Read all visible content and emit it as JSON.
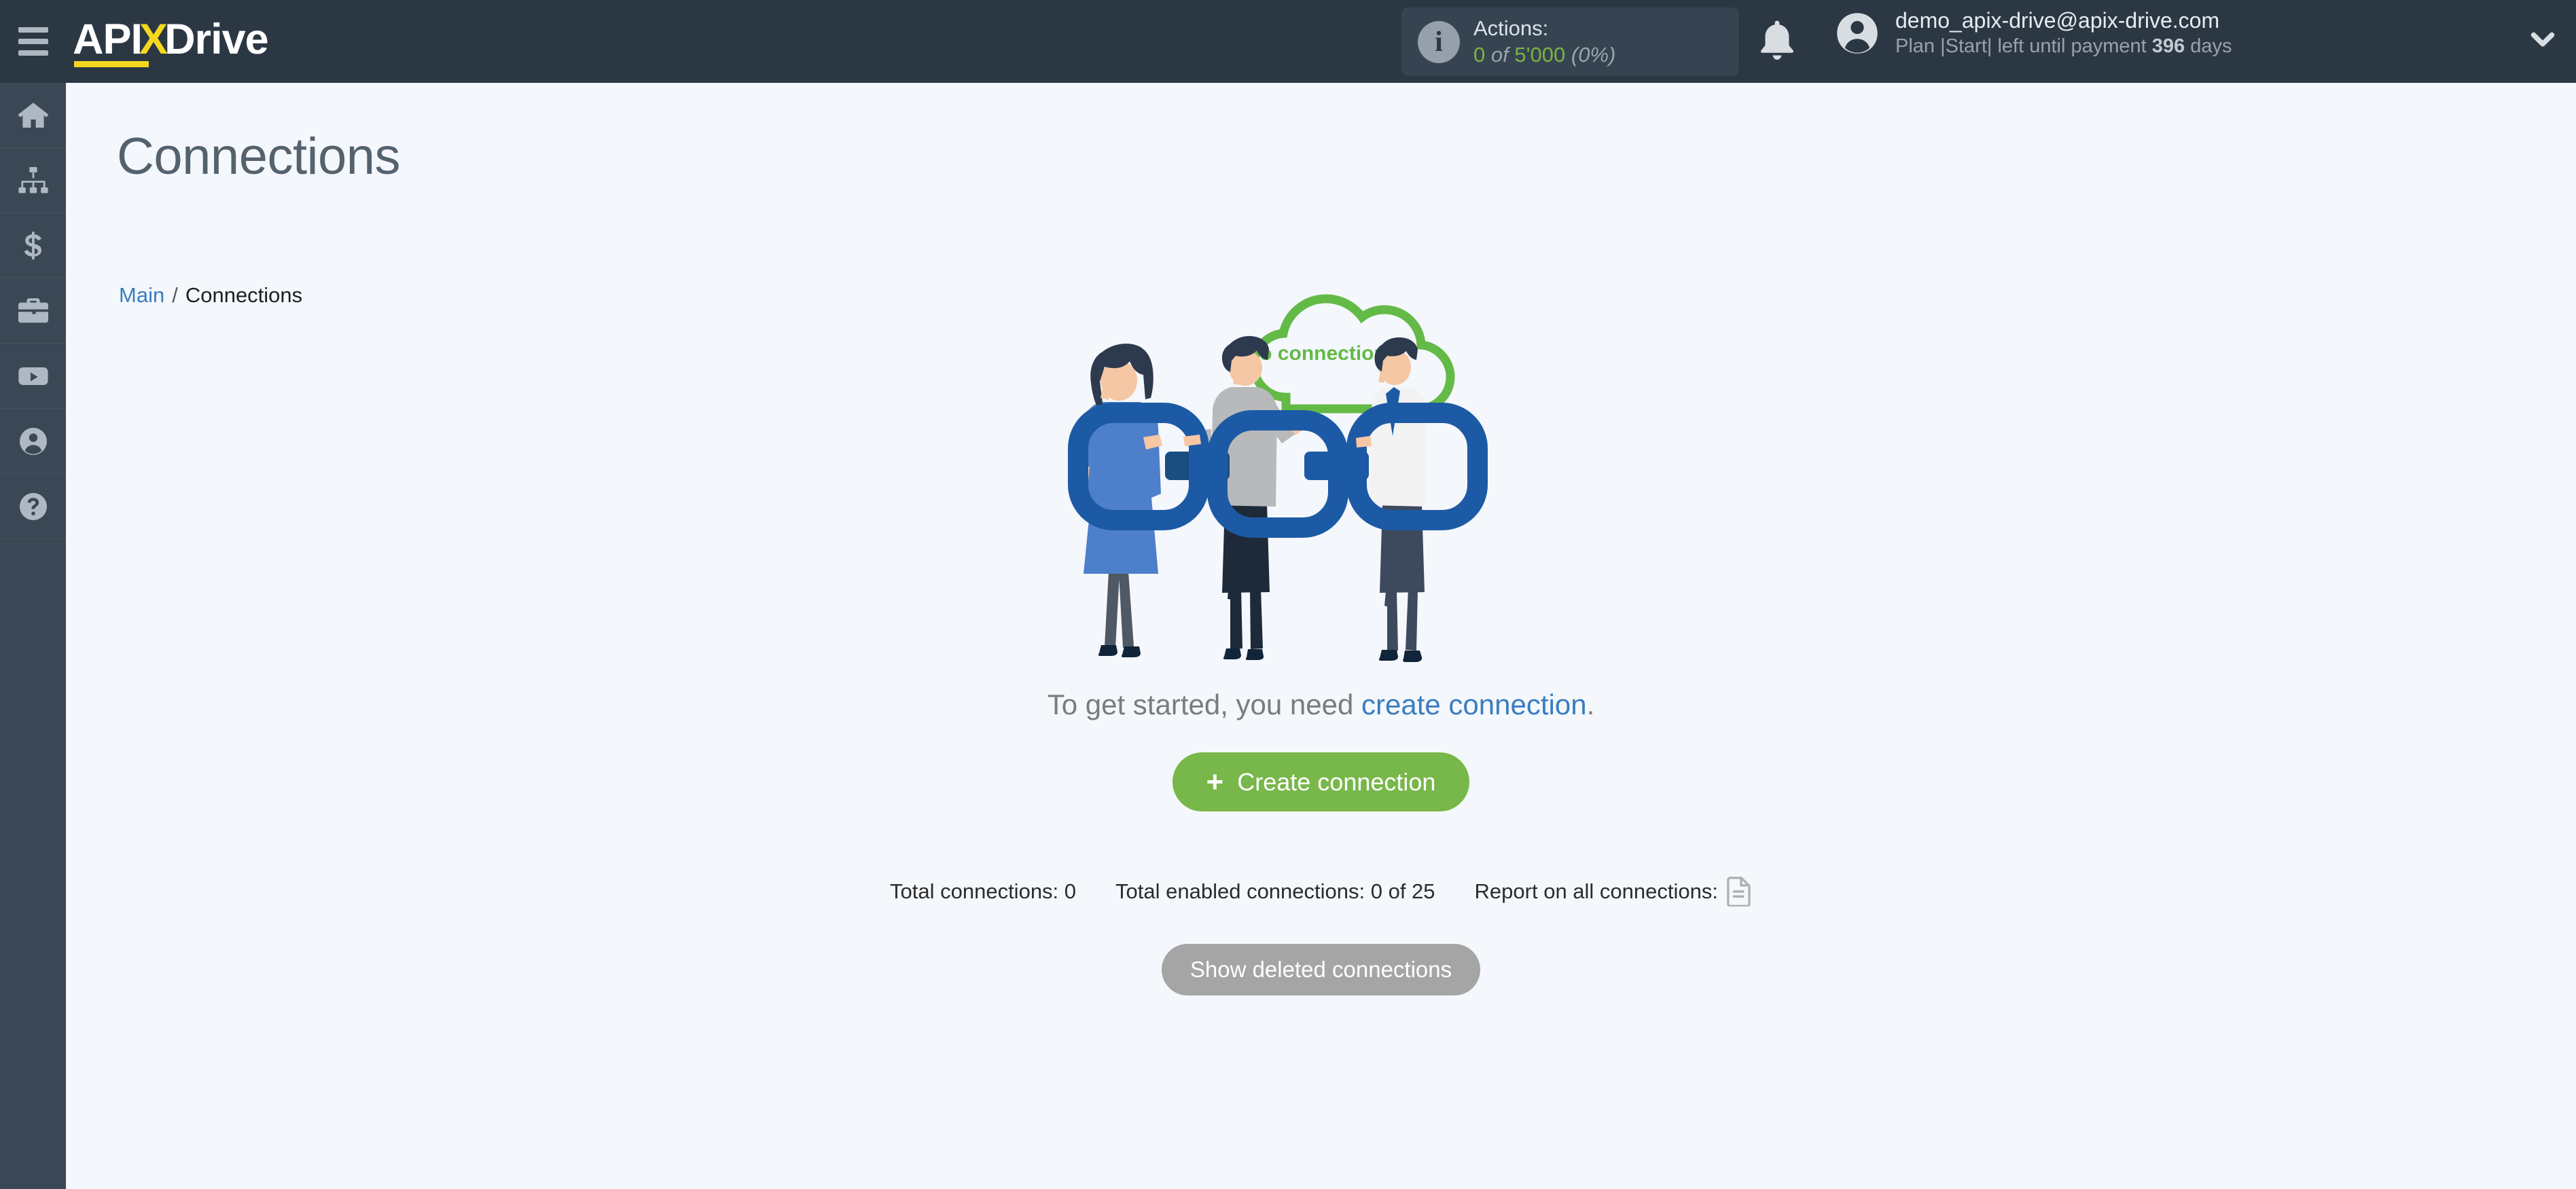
{
  "header": {
    "menu_icon": "hamburger-icon",
    "logo": {
      "part1": "API",
      "part2": "X",
      "part3": "Drive"
    },
    "actions": {
      "info_icon": "info-icon",
      "label": "Actions:",
      "used": "0",
      "of": "of",
      "limit": "5'000",
      "percent": "(0%)"
    },
    "bell_icon": "bell-icon",
    "user": {
      "avatar_icon": "user-avatar-icon",
      "email": "demo_apix-drive@apix-drive.com",
      "plan_prefix": "Plan |Start| left until payment ",
      "plan_days": "396",
      "plan_suffix": " days"
    },
    "chevron_icon": "chevron-down-icon"
  },
  "sidebar": {
    "items": [
      {
        "icon": "home-icon",
        "name": "home"
      },
      {
        "icon": "sitemap-icon",
        "name": "connections"
      },
      {
        "icon": "dollar-icon",
        "name": "payments"
      },
      {
        "icon": "briefcase-icon",
        "name": "business"
      },
      {
        "icon": "video-icon",
        "name": "tutorials"
      },
      {
        "icon": "account-icon",
        "name": "account"
      },
      {
        "icon": "help-icon",
        "name": "help"
      }
    ]
  },
  "page": {
    "title": "Connections",
    "breadcrumb": {
      "root": "Main",
      "separator": "/",
      "current": "Connections"
    }
  },
  "empty_state": {
    "cloud_label": "No connections",
    "cta_prefix": "To get started, you need ",
    "cta_link": "create connection",
    "cta_suffix": ".",
    "create_button": {
      "plus": "+",
      "label": "Create connection"
    }
  },
  "stats": {
    "total_connections": "Total connections: 0",
    "total_enabled": "Total enabled connections: 0 of 25",
    "report_label": "Report on all connections:",
    "report_icon": "document-icon"
  },
  "footer": {
    "show_deleted_button": "Show deleted connections"
  },
  "colors": {
    "header_bg": "#2b3844",
    "sidebar_bg": "#3a4754",
    "content_bg": "#f4f7fb",
    "accent_green": "#78b74a",
    "cloud_green": "#63ba46",
    "link_blue": "#3b7dbf",
    "logo_yellow": "#f5d81e",
    "chain_blue": "#1d5aa5",
    "gray_button": "#a5a5a5"
  }
}
